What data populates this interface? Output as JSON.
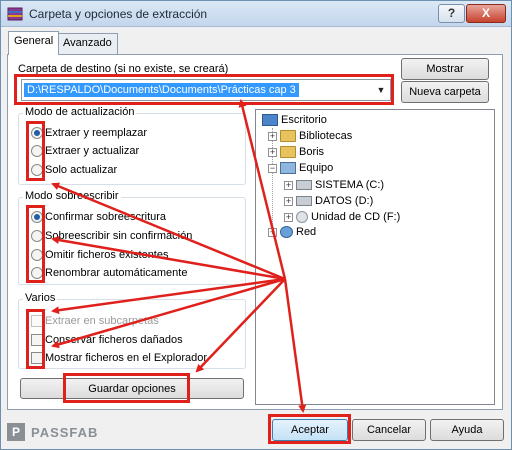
{
  "window": {
    "title": "Carpeta y opciones de extracción",
    "help_label": "?",
    "close_label": "X"
  },
  "tabs": [
    {
      "label": "General",
      "active": true
    },
    {
      "label": "Avanzado",
      "active": false
    }
  ],
  "destination": {
    "label": "Carpeta de destino (si no existe, se creará)",
    "value": "D:\\RESPALDO\\Documents\\Documents\\Prácticas cap 3",
    "show_button": "Mostrar",
    "new_folder_button": "Nueva carpeta"
  },
  "update_mode": {
    "title": "Modo de actualización",
    "options": [
      {
        "label": "Extraer y reemplazar",
        "selected": true
      },
      {
        "label": "Extraer y actualizar",
        "selected": false
      },
      {
        "label": "Solo actualizar",
        "selected": false
      }
    ]
  },
  "overwrite_mode": {
    "title": "Modo sobreescribir",
    "options": [
      {
        "label": "Confirmar sobreescritura",
        "selected": true
      },
      {
        "label": "Sobreescribir sin confirmación",
        "selected": false
      },
      {
        "label": "Omitir ficheros existentes",
        "selected": false
      },
      {
        "label": "Renombrar automáticamente",
        "selected": false
      }
    ]
  },
  "misc": {
    "title": "Varios",
    "options": [
      {
        "label": "Extraer en subcarpetas",
        "checked": false,
        "disabled": true
      },
      {
        "label": "Conservar ficheros dañados",
        "checked": false,
        "disabled": false
      },
      {
        "label": "Mostrar ficheros en el Explorador",
        "checked": false,
        "disabled": false
      }
    ]
  },
  "save_options_button": "Guardar opciones",
  "tree": {
    "root": "Escritorio",
    "items": [
      {
        "label": "Bibliotecas",
        "icon": "folder-icon"
      },
      {
        "label": "Boris",
        "icon": "folder-icon"
      },
      {
        "label": "Equipo",
        "icon": "computer-icon"
      },
      {
        "label": "SISTEMA (C:)",
        "icon": "drive-icon"
      },
      {
        "label": "DATOS (D:)",
        "icon": "drive-icon"
      },
      {
        "label": "Unidad de CD (F:)",
        "icon": "cd-drive-icon"
      },
      {
        "label": "Red",
        "icon": "network-icon"
      }
    ]
  },
  "footer": {
    "logo_text": "PASSFAB",
    "logo_mark": "P",
    "ok_button": "Aceptar",
    "cancel_button": "Cancelar",
    "help_button": "Ayuda"
  },
  "colors": {
    "annotation": "#e0201b",
    "selection": "#3399ff"
  }
}
